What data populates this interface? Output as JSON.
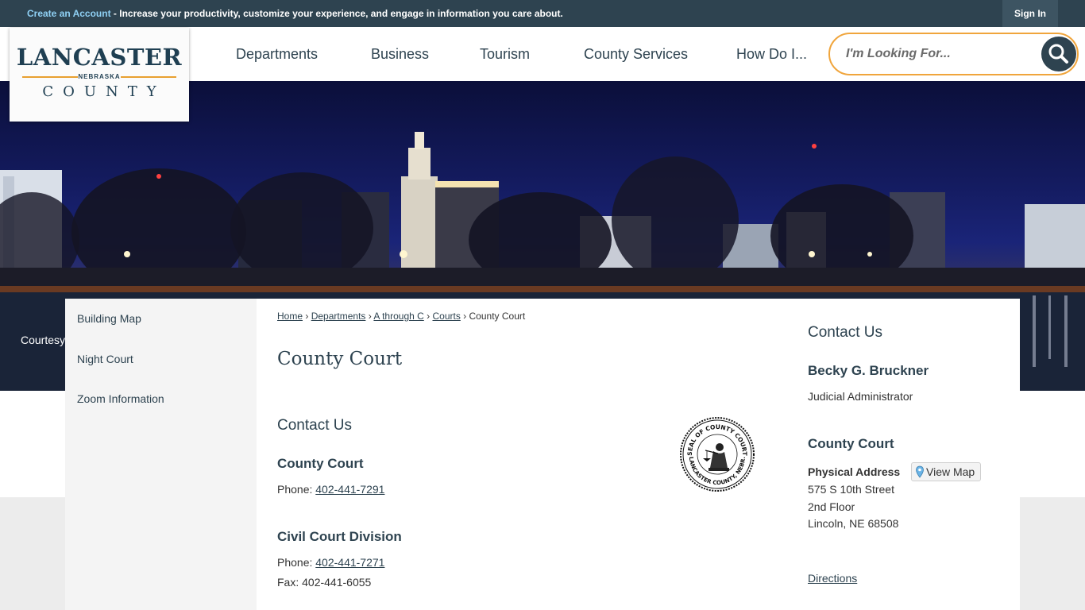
{
  "topbar": {
    "create_account": "Create an Account",
    "promo_text": " - Increase your productivity, customize your experience, and engage in information you care about.",
    "sign_in": "Sign In"
  },
  "logo": {
    "line1": "LANCASTER",
    "line2": "NEBRASKA",
    "line3": "COUNTY"
  },
  "nav": {
    "items": [
      "Departments",
      "Business",
      "Tourism",
      "County Services",
      "How Do I..."
    ]
  },
  "search": {
    "placeholder": "I'm Looking For...",
    "icon": "search-icon"
  },
  "banner": {
    "caption": "Courtesy"
  },
  "sidebar": {
    "items": [
      "Building Map",
      "Night Court",
      "Zoom Information"
    ]
  },
  "breadcrumb": {
    "home": "Home",
    "departments": "Departments",
    "a_through_c": "A through C",
    "courts": "Courts",
    "current": "County Court",
    "sep": "›"
  },
  "page": {
    "title": "County Court"
  },
  "contact_main": {
    "heading": "Contact Us",
    "county_court": {
      "name": "County Court",
      "phone_label": "Phone: ",
      "phone": "402-441-7291"
    },
    "civil": {
      "name": "Civil Court Division",
      "phone_label": "Phone: ",
      "phone": "402-441-7271",
      "fax": "Fax: 402-441-6055"
    }
  },
  "seal": {
    "top_text": "SEAL OF COUNTY COURT",
    "bottom_text": "LANCASTER COUNTY, NEBR."
  },
  "contact_side": {
    "heading": "Contact Us",
    "person_name": "Becky G. Bruckner",
    "person_title": "Judicial Administrator",
    "office": "County Court",
    "address_label": "Physical Address",
    "view_map": "View Map",
    "address_line1": "575 S 10th Street",
    "address_line2": "2nd Floor",
    "address_line3": "Lincoln, NE 68508",
    "directions": "Directions"
  },
  "colors": {
    "navy": "#2e4350",
    "accent_orange": "#f0a53c",
    "link_blue": "#8fd0f4"
  }
}
